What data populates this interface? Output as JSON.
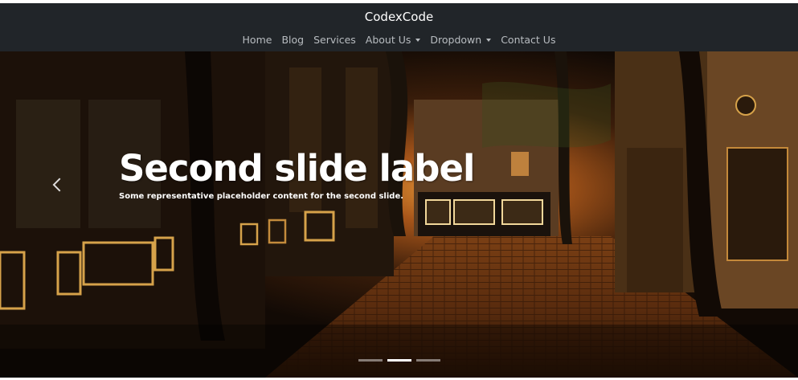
{
  "navbar": {
    "brand": "CodexCode",
    "links": [
      {
        "label": "Home"
      },
      {
        "label": "Blog"
      },
      {
        "label": "Services"
      },
      {
        "label": "About Us"
      },
      {
        "label": "Dropdown"
      },
      {
        "label": "Contact Us"
      }
    ]
  },
  "carousel": {
    "caption_title": "Second slide label",
    "caption_text": "Some representative placeholder content for the second slide.",
    "indicators_count": 3,
    "active_index": 1,
    "prev_icon": "chevron-left-icon"
  },
  "colors": {
    "navbar_bg": "#212529",
    "nav_link": "#b8bcc0",
    "caption": "#ffffff"
  }
}
